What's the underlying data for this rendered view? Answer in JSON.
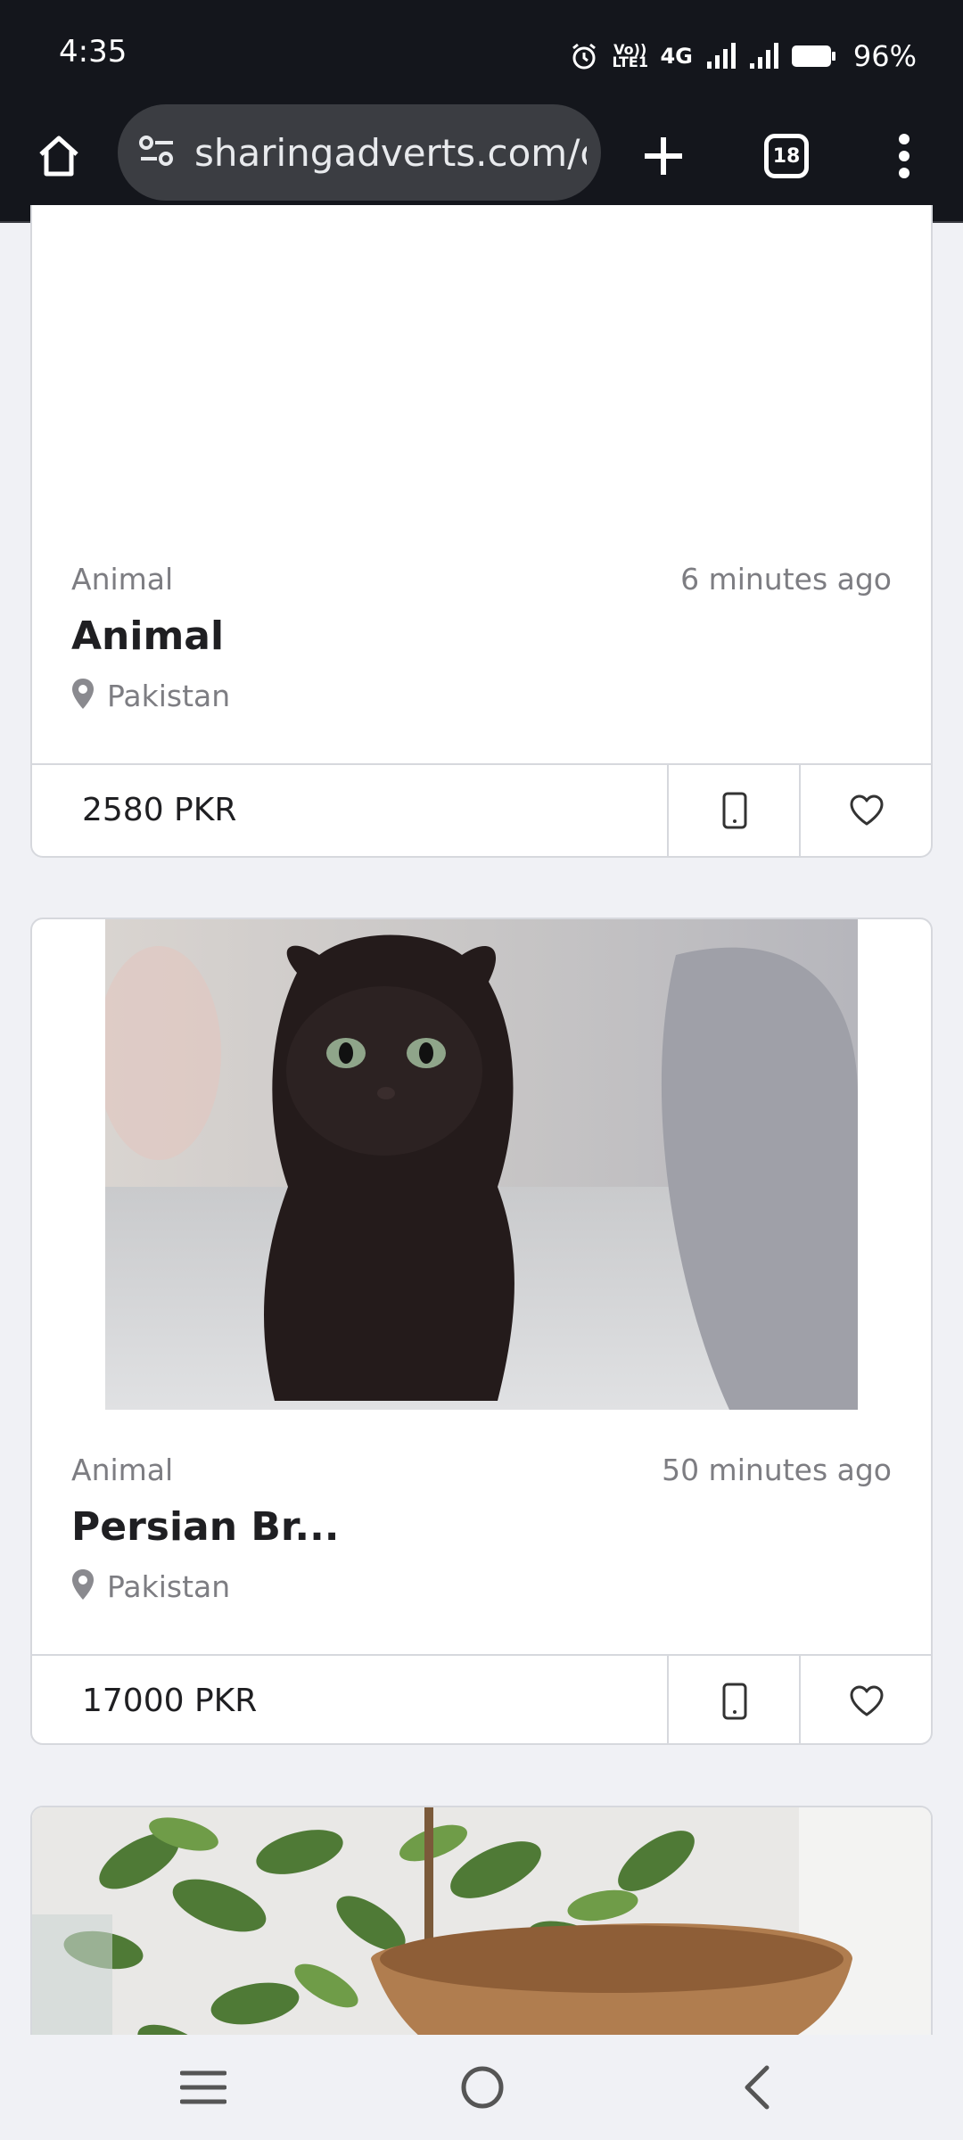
{
  "status_bar": {
    "time": "4:35",
    "volte": "Vo)) LTE1",
    "network": "4G",
    "battery_percent": "96%"
  },
  "browser": {
    "url": "sharingadverts.com/c",
    "tab_count": "18",
    "icons": [
      "home-icon",
      "site-settings-icon",
      "new-tab-plus-icon",
      "tab-switcher-icon",
      "more-vert-icon"
    ]
  },
  "listings": [
    {
      "category": "Animal",
      "time_ago": "6 minutes ago",
      "title": "Animal",
      "location": "Pakistan",
      "price": "2580 PKR"
    },
    {
      "category": "Animal",
      "time_ago": "50 minutes ago",
      "title": "Persian Br...",
      "location": "Pakistan",
      "price": "17000 PKR"
    }
  ],
  "colors": {
    "status_bg": "#14161c",
    "url_bar_bg": "#3b3d42",
    "page_bg": "#f0f1f5",
    "muted_text": "#7d7d82",
    "title_text": "#1f1f22",
    "border": "#d6d8dd"
  }
}
